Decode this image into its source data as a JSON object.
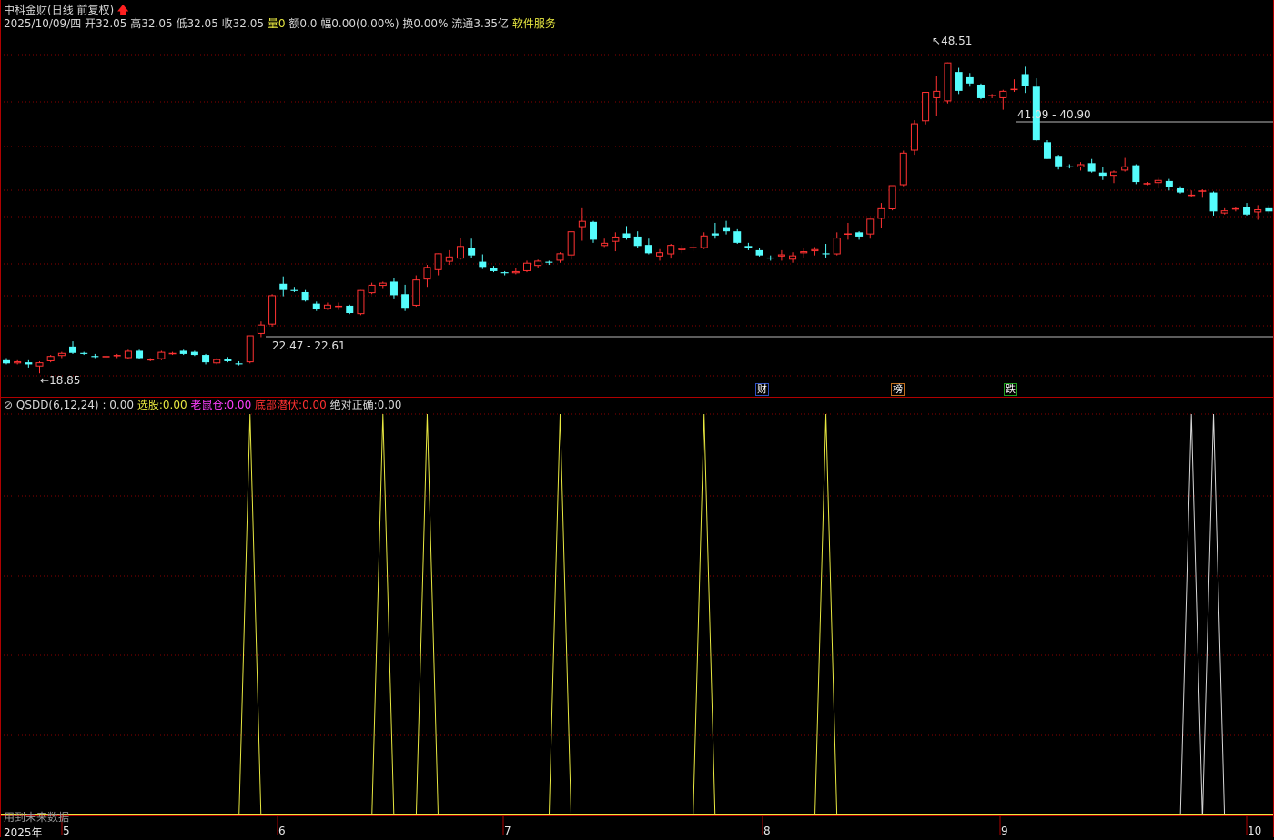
{
  "header": {
    "stock_name": "中科金财",
    "period": "(日线 前复权)",
    "date": "2025/10/09/四",
    "open_label": "开",
    "open": "32.05",
    "high_label": "高",
    "high": "32.05",
    "low_label": "低",
    "low": "32.05",
    "close_label": "收",
    "close": "32.05",
    "vol_label": "量",
    "vol": "0",
    "amount_label": "额",
    "amount": "0.0",
    "change_label": "幅",
    "change": "0.00(0.00%)",
    "turnover_label": "换",
    "turnover": "0.00%",
    "float_label": "流通",
    "float": "3.35亿",
    "service": "软件服务"
  },
  "annotations": {
    "low_mark": "18.85",
    "high_mark": "48.51",
    "support_line": "22.47 - 22.61",
    "resist_line": "41.09 - 40.90"
  },
  "event_tags": [
    "财",
    "榜",
    "跌"
  ],
  "indicator": {
    "name": "QSDD(6,12,24)",
    "v0": ": 0.00",
    "xuangu_label": "选股:",
    "xuangu": "0.00",
    "laoshu_label": "老鼠仓:",
    "laoshu": "0.00",
    "dibu_label": "底部潜伏:",
    "dibu": "0.00",
    "juedui_label": "绝对正确:",
    "juedui": "0.00"
  },
  "footer": {
    "note": "用到未来数据",
    "dates": [
      "2025年",
      "5",
      "6",
      "7",
      "8",
      "9",
      "10"
    ]
  },
  "colors": {
    "up": "#ff3232",
    "down": "#54fcfc",
    "grid": "#8b0000",
    "panel_border": "#b00000",
    "signal_yellow": "#e8e840",
    "signal_white": "#d8d8d8"
  },
  "chart_data": {
    "type": "candlestick",
    "price_range": [
      18.0,
      51.0
    ],
    "candles": [
      [
        20.1,
        20.3,
        19.7,
        19.8
      ],
      [
        19.8,
        20.1,
        19.7,
        20.0
      ],
      [
        19.9,
        20.1,
        19.4,
        19.7
      ],
      [
        19.5,
        20.0,
        18.85,
        19.9
      ],
      [
        20.0,
        20.6,
        19.9,
        20.5
      ],
      [
        20.5,
        20.9,
        20.3,
        20.8
      ],
      [
        21.4,
        21.9,
        20.7,
        20.8
      ],
      [
        20.8,
        20.9,
        20.6,
        20.7
      ],
      [
        20.5,
        20.7,
        20.3,
        20.4
      ],
      [
        20.4,
        20.6,
        20.3,
        20.5
      ],
      [
        20.5,
        20.7,
        20.3,
        20.6
      ],
      [
        20.3,
        21.1,
        20.2,
        21.0
      ],
      [
        21.0,
        21.1,
        20.2,
        20.3
      ],
      [
        20.1,
        20.3,
        20.0,
        20.2
      ],
      [
        20.2,
        21.0,
        20.1,
        20.9
      ],
      [
        20.7,
        20.9,
        20.6,
        20.8
      ],
      [
        21.0,
        21.1,
        20.6,
        20.7
      ],
      [
        20.9,
        21.0,
        20.5,
        20.6
      ],
      [
        20.6,
        20.7,
        19.7,
        19.9
      ],
      [
        19.8,
        20.3,
        19.7,
        20.2
      ],
      [
        20.2,
        20.4,
        19.9,
        20.0
      ],
      [
        19.8,
        20.0,
        19.6,
        19.7
      ],
      [
        19.9,
        22.47,
        19.8,
        22.47
      ],
      [
        22.61,
        23.8,
        22.3,
        23.5
      ],
      [
        23.5,
        26.4,
        23.3,
        26.3
      ],
      [
        27.4,
        28.1,
        26.2,
        26.8
      ],
      [
        26.8,
        27.1,
        26.6,
        26.7
      ],
      [
        26.6,
        26.8,
        25.7,
        25.8
      ],
      [
        25.5,
        25.7,
        24.8,
        25.0
      ],
      [
        25.0,
        25.6,
        24.9,
        25.4
      ],
      [
        25.2,
        25.6,
        24.9,
        25.3
      ],
      [
        25.3,
        25.4,
        24.5,
        24.6
      ],
      [
        24.5,
        26.8,
        24.4,
        26.8
      ],
      [
        26.5,
        27.5,
        26.4,
        27.3
      ],
      [
        27.2,
        27.6,
        26.9,
        27.5
      ],
      [
        27.6,
        27.9,
        26.0,
        26.3
      ],
      [
        26.4,
        27.3,
        24.8,
        25.1
      ],
      [
        25.3,
        28.2,
        25.2,
        27.8
      ],
      [
        27.8,
        29.2,
        27.1,
        29.0
      ],
      [
        28.7,
        30.3,
        28.2,
        30.3
      ],
      [
        29.5,
        30.6,
        29.2,
        30.0
      ],
      [
        29.8,
        31.8,
        29.7,
        31.0
      ],
      [
        30.8,
        31.7,
        29.9,
        30.1
      ],
      [
        29.5,
        30.2,
        28.8,
        29.0
      ],
      [
        28.9,
        29.1,
        28.5,
        28.6
      ],
      [
        28.5,
        28.6,
        28.2,
        28.4
      ],
      [
        28.4,
        28.9,
        28.3,
        28.6
      ],
      [
        28.6,
        29.6,
        28.5,
        29.4
      ],
      [
        29.1,
        29.7,
        28.9,
        29.6
      ],
      [
        29.5,
        29.6,
        29.2,
        29.4
      ],
      [
        29.6,
        30.4,
        29.4,
        30.3
      ],
      [
        30.1,
        32.4,
        29.7,
        32.4
      ],
      [
        32.8,
        34.6,
        31.5,
        33.4
      ],
      [
        33.3,
        33.4,
        31.3,
        31.6
      ],
      [
        31.0,
        31.7,
        30.9,
        31.3
      ],
      [
        31.4,
        32.3,
        30.5,
        31.9
      ],
      [
        32.2,
        32.9,
        31.6,
        31.8
      ],
      [
        31.9,
        32.4,
        30.8,
        31.0
      ],
      [
        31.1,
        31.7,
        30.2,
        30.3
      ],
      [
        30.0,
        30.7,
        29.6,
        30.4
      ],
      [
        30.2,
        31.2,
        29.8,
        31.1
      ],
      [
        30.6,
        31.1,
        30.3,
        30.8
      ],
      [
        30.9,
        31.3,
        30.5,
        30.9
      ],
      [
        30.8,
        32.3,
        30.7,
        32.0
      ],
      [
        32.2,
        33.2,
        31.7,
        32.0
      ],
      [
        32.8,
        33.4,
        32.1,
        32.4
      ],
      [
        32.4,
        32.6,
        31.2,
        31.3
      ],
      [
        31.0,
        31.3,
        30.6,
        30.8
      ],
      [
        30.6,
        30.8,
        30.0,
        30.1
      ],
      [
        29.9,
        30.1,
        29.6,
        29.8
      ],
      [
        30.0,
        30.6,
        29.6,
        30.2
      ],
      [
        29.7,
        30.4,
        29.4,
        30.1
      ],
      [
        30.3,
        30.8,
        29.9,
        30.5
      ],
      [
        30.5,
        30.9,
        30.1,
        30.7
      ],
      [
        30.3,
        31.2,
        29.9,
        30.2
      ],
      [
        30.2,
        32.3,
        30.1,
        31.8
      ],
      [
        32.2,
        33.2,
        31.6,
        32.2
      ],
      [
        32.3,
        32.4,
        31.6,
        31.9
      ],
      [
        32.1,
        33.6,
        31.7,
        33.6
      ],
      [
        33.6,
        35.1,
        32.7,
        34.6
      ],
      [
        34.5,
        36.8,
        34.4,
        36.8
      ],
      [
        36.8,
        40.1,
        36.7,
        39.9
      ],
      [
        40.1,
        43.0,
        39.7,
        42.7
      ],
      [
        42.9,
        45.7,
        42.6,
        45.7
      ],
      [
        45.1,
        47.2,
        43.4,
        45.8
      ],
      [
        44.8,
        48.51,
        44.6,
        48.51
      ],
      [
        47.6,
        48.0,
        45.5,
        45.8
      ],
      [
        47.1,
        47.5,
        46.2,
        46.5
      ],
      [
        46.4,
        46.5,
        45.0,
        45.1
      ],
      [
        45.3,
        45.5,
        45.1,
        45.4
      ],
      [
        45.1,
        45.9,
        44.0,
        45.8
      ],
      [
        46.0,
        46.9,
        45.7,
        46.0
      ],
      [
        47.4,
        48.1,
        45.6,
        46.3
      ],
      [
        46.2,
        47.0,
        41.0,
        41.09
      ],
      [
        40.9,
        41.1,
        39.3,
        39.3
      ],
      [
        39.6,
        39.7,
        38.3,
        38.6
      ],
      [
        38.6,
        38.8,
        38.4,
        38.5
      ],
      [
        38.5,
        39.0,
        38.2,
        38.8
      ],
      [
        38.9,
        39.3,
        38.0,
        38.1
      ],
      [
        38.0,
        38.5,
        37.3,
        37.7
      ],
      [
        37.7,
        38.2,
        37.0,
        38.1
      ],
      [
        38.2,
        39.4,
        38.1,
        38.6
      ],
      [
        38.7,
        38.8,
        36.9,
        37.1
      ],
      [
        36.9,
        37.1,
        36.8,
        37.0
      ],
      [
        37.0,
        37.5,
        36.5,
        37.3
      ],
      [
        37.2,
        37.4,
        36.3,
        36.6
      ],
      [
        36.5,
        36.7,
        36.0,
        36.1
      ],
      [
        35.8,
        36.3,
        35.7,
        35.9
      ],
      [
        36.2,
        36.4,
        35.6,
        36.3
      ],
      [
        36.1,
        36.2,
        33.9,
        34.3
      ],
      [
        34.1,
        34.6,
        34.0,
        34.4
      ],
      [
        34.5,
        34.7,
        34.3,
        34.6
      ],
      [
        34.7,
        35.1,
        33.9,
        34.0
      ],
      [
        34.2,
        34.9,
        33.5,
        34.5
      ],
      [
        34.6,
        34.9,
        34.1,
        34.3
      ],
      [
        34.3,
        34.4,
        34.2,
        34.25
      ]
    ],
    "indicator_spikes": [
      {
        "index": 22,
        "color": "yellow"
      },
      {
        "index": 34,
        "color": "yellow"
      },
      {
        "index": 38,
        "color": "yellow"
      },
      {
        "index": 50,
        "color": "yellow"
      },
      {
        "index": 63,
        "color": "yellow"
      },
      {
        "index": 74,
        "color": "yellow"
      },
      {
        "index": 107,
        "color": "white"
      },
      {
        "index": 109,
        "color": "white"
      }
    ]
  }
}
